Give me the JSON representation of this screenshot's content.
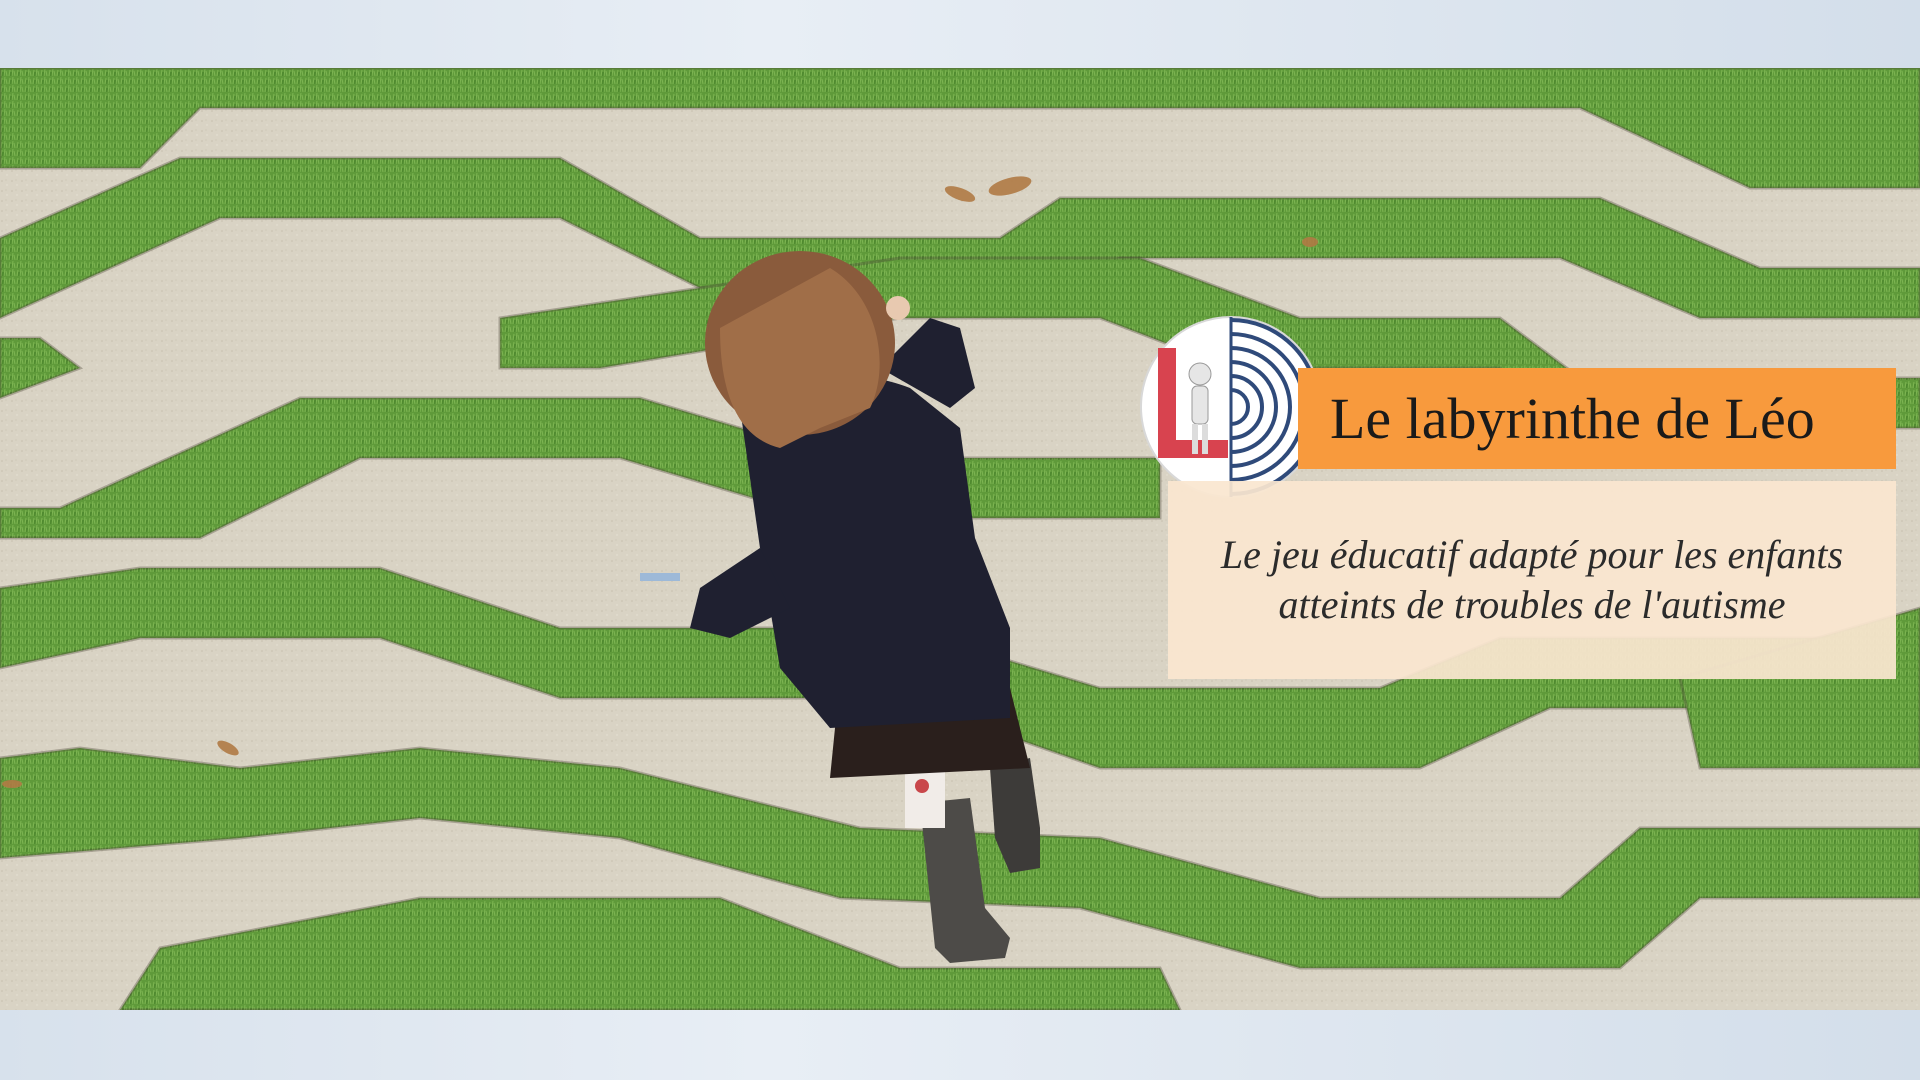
{
  "hero": {
    "image": "child-walking-in-grass-maze",
    "title": "Le labyrinthe de Léo",
    "subtitle": "Le jeu éducatif adapté pour les enfants atteints de troubles de l'autisme",
    "logo": "leo-labyrinth-logo-icon"
  },
  "colors": {
    "title_bar": "#f89a3d",
    "subtitle_box": "#fae6d0",
    "grass": "#5f9a3a",
    "path": "#d8d2c3",
    "logo_blue": "#2f4a7a",
    "logo_red": "#d8434f"
  }
}
